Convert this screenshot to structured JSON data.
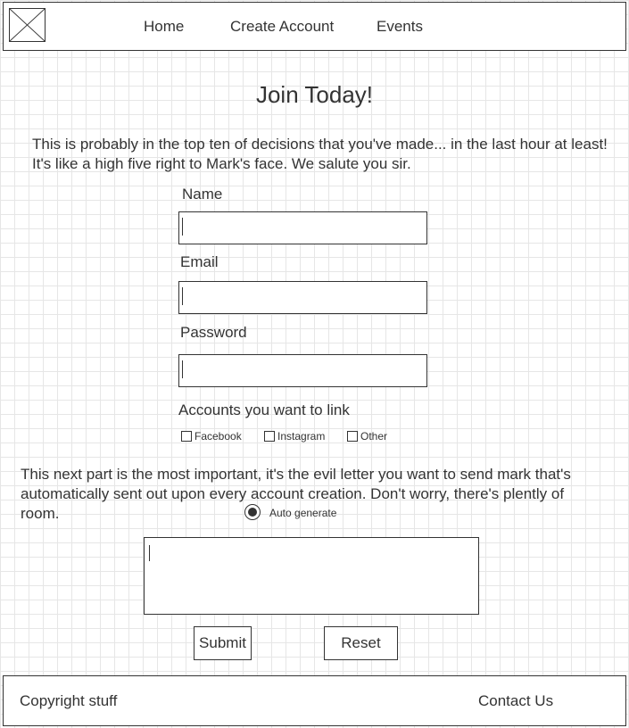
{
  "header": {
    "nav": [
      {
        "label": "Home"
      },
      {
        "label": "Create Account"
      },
      {
        "label": "Events"
      }
    ]
  },
  "main": {
    "title": "Join Today!",
    "intro": "This is probably in the top ten of decisions that you've made... in the last hour at least! It's like a high five right to Mark's face. We salute you sir.",
    "form": {
      "name_label": "Name",
      "name_value": "",
      "email_label": "Email",
      "email_value": "",
      "password_label": "Password",
      "password_value": "",
      "accounts_label": "Accounts you want to link",
      "accounts": [
        {
          "label": "Facebook",
          "checked": false
        },
        {
          "label": "Instagram",
          "checked": false
        },
        {
          "label": "Other",
          "checked": false
        }
      ]
    },
    "letter": {
      "description": "This next part is the most important, it's the evil letter you want to send mark that's automatically sent out upon every account creation.  Don't worry, there's plently of room.",
      "radio_label": "Auto generate",
      "radio_selected": true,
      "text": ""
    },
    "buttons": {
      "submit": "Submit",
      "reset": "Reset"
    }
  },
  "footer": {
    "left": "Copyright stuff",
    "right": "Contact Us"
  }
}
